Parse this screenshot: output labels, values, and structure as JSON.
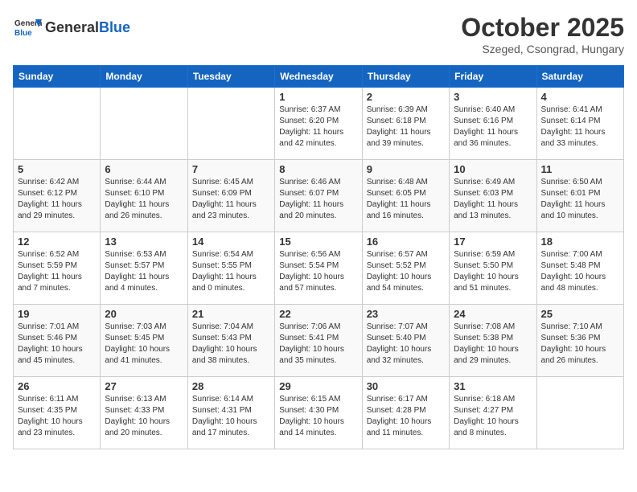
{
  "header": {
    "logo_general": "General",
    "logo_blue": "Blue",
    "month": "October 2025",
    "location": "Szeged, Csongrad, Hungary"
  },
  "days_of_week": [
    "Sunday",
    "Monday",
    "Tuesday",
    "Wednesday",
    "Thursday",
    "Friday",
    "Saturday"
  ],
  "weeks": [
    [
      {
        "day": "",
        "info": ""
      },
      {
        "day": "",
        "info": ""
      },
      {
        "day": "",
        "info": ""
      },
      {
        "day": "1",
        "info": "Sunrise: 6:37 AM\nSunset: 6:20 PM\nDaylight: 11 hours\nand 42 minutes."
      },
      {
        "day": "2",
        "info": "Sunrise: 6:39 AM\nSunset: 6:18 PM\nDaylight: 11 hours\nand 39 minutes."
      },
      {
        "day": "3",
        "info": "Sunrise: 6:40 AM\nSunset: 6:16 PM\nDaylight: 11 hours\nand 36 minutes."
      },
      {
        "day": "4",
        "info": "Sunrise: 6:41 AM\nSunset: 6:14 PM\nDaylight: 11 hours\nand 33 minutes."
      }
    ],
    [
      {
        "day": "5",
        "info": "Sunrise: 6:42 AM\nSunset: 6:12 PM\nDaylight: 11 hours\nand 29 minutes."
      },
      {
        "day": "6",
        "info": "Sunrise: 6:44 AM\nSunset: 6:10 PM\nDaylight: 11 hours\nand 26 minutes."
      },
      {
        "day": "7",
        "info": "Sunrise: 6:45 AM\nSunset: 6:09 PM\nDaylight: 11 hours\nand 23 minutes."
      },
      {
        "day": "8",
        "info": "Sunrise: 6:46 AM\nSunset: 6:07 PM\nDaylight: 11 hours\nand 20 minutes."
      },
      {
        "day": "9",
        "info": "Sunrise: 6:48 AM\nSunset: 6:05 PM\nDaylight: 11 hours\nand 16 minutes."
      },
      {
        "day": "10",
        "info": "Sunrise: 6:49 AM\nSunset: 6:03 PM\nDaylight: 11 hours\nand 13 minutes."
      },
      {
        "day": "11",
        "info": "Sunrise: 6:50 AM\nSunset: 6:01 PM\nDaylight: 11 hours\nand 10 minutes."
      }
    ],
    [
      {
        "day": "12",
        "info": "Sunrise: 6:52 AM\nSunset: 5:59 PM\nDaylight: 11 hours\nand 7 minutes."
      },
      {
        "day": "13",
        "info": "Sunrise: 6:53 AM\nSunset: 5:57 PM\nDaylight: 11 hours\nand 4 minutes."
      },
      {
        "day": "14",
        "info": "Sunrise: 6:54 AM\nSunset: 5:55 PM\nDaylight: 11 hours\nand 0 minutes."
      },
      {
        "day": "15",
        "info": "Sunrise: 6:56 AM\nSunset: 5:54 PM\nDaylight: 10 hours\nand 57 minutes."
      },
      {
        "day": "16",
        "info": "Sunrise: 6:57 AM\nSunset: 5:52 PM\nDaylight: 10 hours\nand 54 minutes."
      },
      {
        "day": "17",
        "info": "Sunrise: 6:59 AM\nSunset: 5:50 PM\nDaylight: 10 hours\nand 51 minutes."
      },
      {
        "day": "18",
        "info": "Sunrise: 7:00 AM\nSunset: 5:48 PM\nDaylight: 10 hours\nand 48 minutes."
      }
    ],
    [
      {
        "day": "19",
        "info": "Sunrise: 7:01 AM\nSunset: 5:46 PM\nDaylight: 10 hours\nand 45 minutes."
      },
      {
        "day": "20",
        "info": "Sunrise: 7:03 AM\nSunset: 5:45 PM\nDaylight: 10 hours\nand 41 minutes."
      },
      {
        "day": "21",
        "info": "Sunrise: 7:04 AM\nSunset: 5:43 PM\nDaylight: 10 hours\nand 38 minutes."
      },
      {
        "day": "22",
        "info": "Sunrise: 7:06 AM\nSunset: 5:41 PM\nDaylight: 10 hours\nand 35 minutes."
      },
      {
        "day": "23",
        "info": "Sunrise: 7:07 AM\nSunset: 5:40 PM\nDaylight: 10 hours\nand 32 minutes."
      },
      {
        "day": "24",
        "info": "Sunrise: 7:08 AM\nSunset: 5:38 PM\nDaylight: 10 hours\nand 29 minutes."
      },
      {
        "day": "25",
        "info": "Sunrise: 7:10 AM\nSunset: 5:36 PM\nDaylight: 10 hours\nand 26 minutes."
      }
    ],
    [
      {
        "day": "26",
        "info": "Sunrise: 6:11 AM\nSunset: 4:35 PM\nDaylight: 10 hours\nand 23 minutes."
      },
      {
        "day": "27",
        "info": "Sunrise: 6:13 AM\nSunset: 4:33 PM\nDaylight: 10 hours\nand 20 minutes."
      },
      {
        "day": "28",
        "info": "Sunrise: 6:14 AM\nSunset: 4:31 PM\nDaylight: 10 hours\nand 17 minutes."
      },
      {
        "day": "29",
        "info": "Sunrise: 6:15 AM\nSunset: 4:30 PM\nDaylight: 10 hours\nand 14 minutes."
      },
      {
        "day": "30",
        "info": "Sunrise: 6:17 AM\nSunset: 4:28 PM\nDaylight: 10 hours\nand 11 minutes."
      },
      {
        "day": "31",
        "info": "Sunrise: 6:18 AM\nSunset: 4:27 PM\nDaylight: 10 hours\nand 8 minutes."
      },
      {
        "day": "",
        "info": ""
      }
    ]
  ]
}
